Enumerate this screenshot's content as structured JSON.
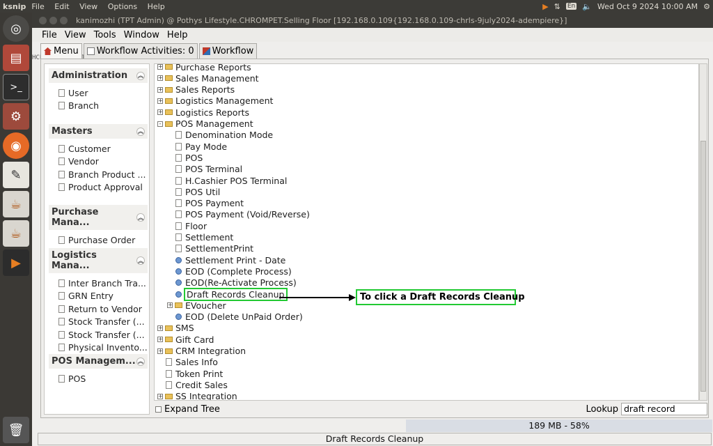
{
  "top_panel": {
    "app_name": "ksnip",
    "menu": [
      "File",
      "Edit",
      "View",
      "Options",
      "Help"
    ],
    "lang": "En",
    "datetime": "Wed Oct  9 2024 10:00 AM"
  },
  "window": {
    "title": "kanimozhi (TPT Admin) @ Pothys Lifestyle.CHROMPET.Selling Floor [192.168.0.109{192.168.0.109-chrls-9july2024-adempiere}]",
    "menu": [
      "File",
      "View",
      "Tools",
      "Window",
      "Help"
    ],
    "tabs": [
      {
        "label": "Menu"
      },
      {
        "label": "Workflow Activities: 0"
      },
      {
        "label": "Workflow"
      }
    ],
    "vstrip": "HCEGIOLEAREIEIEDI3VCMPIRDUEIEEE"
  },
  "left_panel": {
    "groups": [
      {
        "title": "Administration",
        "items": [
          "User",
          "Branch"
        ]
      },
      {
        "title": "Masters",
        "items": [
          "Customer",
          "Vendor",
          "Branch Product ...",
          "Product Approval"
        ]
      },
      {
        "title": "Purchase Mana...",
        "items": [
          "Purchase Order"
        ]
      },
      {
        "title": "Logistics Mana...",
        "items": [
          "Inter Branch Tra...",
          "GRN Entry",
          "Return to Vendor",
          "Stock Transfer (...",
          "Stock Transfer (...",
          "Physical Invento..."
        ]
      },
      {
        "title": "POS Managem...",
        "items": [
          "POS"
        ]
      }
    ]
  },
  "tree": {
    "rows": [
      {
        "label": "Purchase Reports",
        "type": "folder",
        "level": 0,
        "exp": "+"
      },
      {
        "label": "Sales Management",
        "type": "folder",
        "level": 0,
        "exp": "+"
      },
      {
        "label": "Sales Reports",
        "type": "folder",
        "level": 0,
        "exp": "+"
      },
      {
        "label": "Logistics Management",
        "type": "folder",
        "level": 0,
        "exp": "+"
      },
      {
        "label": "Logistics Reports",
        "type": "folder",
        "level": 0,
        "exp": "+"
      },
      {
        "label": "POS Management",
        "type": "folder",
        "level": 0,
        "exp": "-"
      },
      {
        "label": "Denomination Mode",
        "type": "window",
        "level": 1
      },
      {
        "label": "Pay Mode",
        "type": "window",
        "level": 1
      },
      {
        "label": "POS",
        "type": "window",
        "level": 1
      },
      {
        "label": "POS Terminal",
        "type": "window",
        "level": 1
      },
      {
        "label": "H.Cashier POS Terminal",
        "type": "window",
        "level": 1
      },
      {
        "label": "POS Util",
        "type": "window",
        "level": 1
      },
      {
        "label": "POS Payment",
        "type": "window",
        "level": 1
      },
      {
        "label": "POS Payment (Void/Reverse)",
        "type": "window",
        "level": 1
      },
      {
        "label": "Floor",
        "type": "window",
        "level": 1
      },
      {
        "label": "Settlement",
        "type": "window",
        "level": 1
      },
      {
        "label": "SettlementPrint",
        "type": "report",
        "level": 1
      },
      {
        "label": "Settlement Print - Date",
        "type": "process",
        "level": 1
      },
      {
        "label": "EOD (Complete Process)",
        "type": "process",
        "level": 1
      },
      {
        "label": "EOD(Re-Activate Process)",
        "type": "process",
        "level": 1
      },
      {
        "label": "Draft Records Cleanup",
        "type": "process",
        "level": 1,
        "highlight": true
      },
      {
        "label": "EVoucher",
        "type": "folder",
        "level": 1,
        "exp": "+"
      },
      {
        "label": "EOD (Delete UnPaid Order)",
        "type": "process",
        "level": 1
      },
      {
        "label": "SMS",
        "type": "folder",
        "level": 0,
        "exp": "+"
      },
      {
        "label": "Gift Card",
        "type": "folder",
        "level": 0,
        "exp": "+"
      },
      {
        "label": "CRM Integration",
        "type": "folder",
        "level": 0,
        "exp": "+"
      },
      {
        "label": "Sales Info",
        "type": "report",
        "level": 0
      },
      {
        "label": "Token Print",
        "type": "report",
        "level": 0
      },
      {
        "label": "Credit Sales",
        "type": "report",
        "level": 0
      },
      {
        "label": "SS Integration",
        "type": "folder",
        "level": 0,
        "exp": "+"
      }
    ]
  },
  "annotation": {
    "text": "To click a Draft Records Cleanup"
  },
  "bottom": {
    "expand_tree_label": "Expand Tree",
    "lookup_label": "Lookup",
    "lookup_value": "draft record",
    "memory": "189 MB - 58%",
    "status": "Draft Records Cleanup"
  }
}
